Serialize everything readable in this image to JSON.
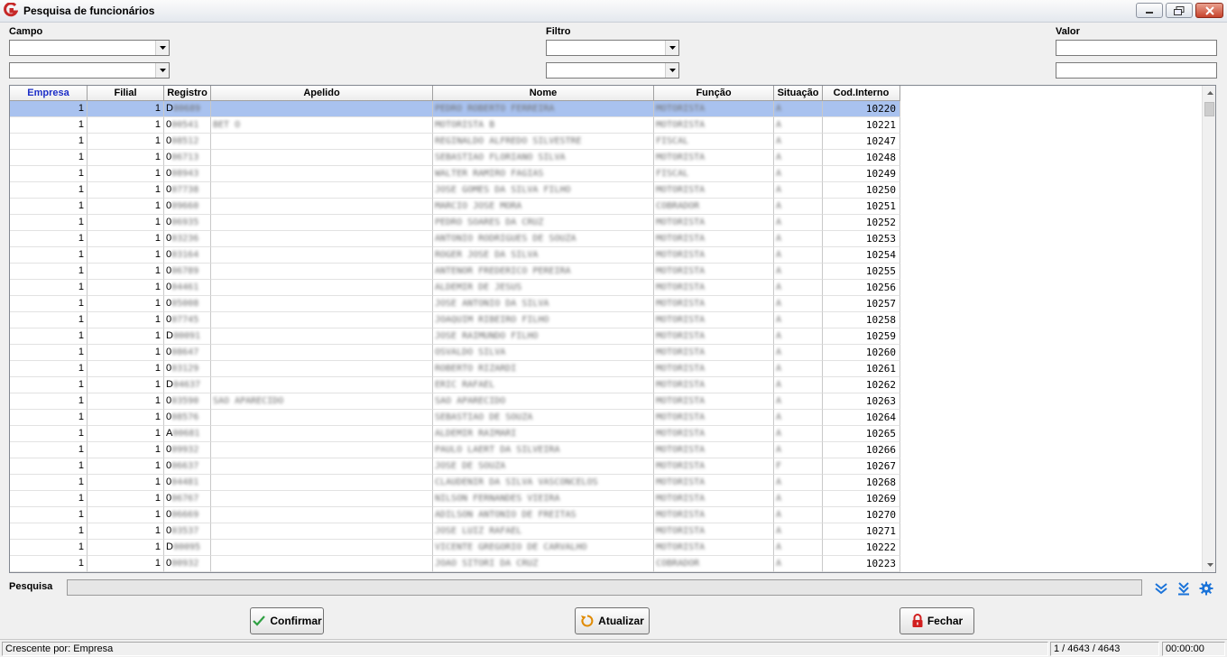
{
  "window": {
    "title": "Pesquisa de funcionários",
    "controls": {
      "minimize": "minimize-icon",
      "restore": "restore-icon",
      "close": "close-icon"
    }
  },
  "filters": {
    "campo_label": "Campo",
    "filtro_label": "Filtro",
    "valor_label": "Valor",
    "campo_values": [
      "",
      ""
    ],
    "filtro_values": [
      "",
      ""
    ],
    "valor_values": [
      "",
      ""
    ]
  },
  "grid": {
    "columns": [
      "Empresa",
      "Filial",
      "Registro",
      "Apelido",
      "Nome",
      "Função",
      "Situação",
      "Cod.Interno"
    ],
    "sorted_column": "Empresa",
    "selected_row": 0,
    "rows": [
      {
        "empresa": "1",
        "filial": "1",
        "registro": "D00689",
        "apelido": "",
        "nome": "PEDRO ROBERTO FERREIRA",
        "funcao": "MOTORISTA",
        "situacao": "A",
        "cod": "10220"
      },
      {
        "empresa": "1",
        "filial": "1",
        "registro": "000541",
        "apelido": "BET O",
        "nome": "MOTORISTA B",
        "funcao": "MOTORISTA",
        "situacao": "A",
        "cod": "10221"
      },
      {
        "empresa": "1",
        "filial": "1",
        "registro": "008512",
        "apelido": "",
        "nome": "REGINALDO ALFREDO SILVESTRE",
        "funcao": "FISCAL",
        "situacao": "A",
        "cod": "10247"
      },
      {
        "empresa": "1",
        "filial": "1",
        "registro": "006713",
        "apelido": "",
        "nome": "SEBASTIAO FLORIANO SILVA",
        "funcao": "MOTORISTA",
        "situacao": "A",
        "cod": "10248"
      },
      {
        "empresa": "1",
        "filial": "1",
        "registro": "008943",
        "apelido": "",
        "nome": "WALTER RAMIRO FAGIAS",
        "funcao": "FISCAL",
        "situacao": "A",
        "cod": "10249"
      },
      {
        "empresa": "1",
        "filial": "1",
        "registro": "007738",
        "apelido": "",
        "nome": "JOSE GOMES DA SILVA FILHO",
        "funcao": "MOTORISTA",
        "situacao": "A",
        "cod": "10250"
      },
      {
        "empresa": "1",
        "filial": "1",
        "registro": "009660",
        "apelido": "",
        "nome": "MARCIO JOSE MORA",
        "funcao": "COBRADOR",
        "situacao": "A",
        "cod": "10251"
      },
      {
        "empresa": "1",
        "filial": "1",
        "registro": "006935",
        "apelido": "",
        "nome": "PEDRO SOARES DA CRUZ",
        "funcao": "MOTORISTA",
        "situacao": "A",
        "cod": "10252"
      },
      {
        "empresa": "1",
        "filial": "1",
        "registro": "003236",
        "apelido": "",
        "nome": "ANTONIO RODRIGUES DE SOUZA",
        "funcao": "MOTORISTA",
        "situacao": "A",
        "cod": "10253"
      },
      {
        "empresa": "1",
        "filial": "1",
        "registro": "003164",
        "apelido": "",
        "nome": "ROGER JOSE DA SILVA",
        "funcao": "MOTORISTA",
        "situacao": "A",
        "cod": "10254"
      },
      {
        "empresa": "1",
        "filial": "1",
        "registro": "006789",
        "apelido": "",
        "nome": "ANTENOR FREDERICO PEREIRA",
        "funcao": "MOTORISTA",
        "situacao": "A",
        "cod": "10255"
      },
      {
        "empresa": "1",
        "filial": "1",
        "registro": "004461",
        "apelido": "",
        "nome": "ALDEMIR DE JESUS",
        "funcao": "MOTORISTA",
        "situacao": "A",
        "cod": "10256"
      },
      {
        "empresa": "1",
        "filial": "1",
        "registro": "005008",
        "apelido": "",
        "nome": "JOSE ANTONIO DA SILVA",
        "funcao": "MOTORISTA",
        "situacao": "A",
        "cod": "10257"
      },
      {
        "empresa": "1",
        "filial": "1",
        "registro": "007745",
        "apelido": "",
        "nome": "JOAQUIM RIBEIRO FILHO",
        "funcao": "MOTORISTA",
        "situacao": "A",
        "cod": "10258"
      },
      {
        "empresa": "1",
        "filial": "1",
        "registro": "D00091",
        "apelido": "",
        "nome": "JOSE RAIMUNDO FILHO",
        "funcao": "MOTORISTA",
        "situacao": "A",
        "cod": "10259"
      },
      {
        "empresa": "1",
        "filial": "1",
        "registro": "008647",
        "apelido": "",
        "nome": "OSVALDO SILVA",
        "funcao": "MOTORISTA",
        "situacao": "A",
        "cod": "10260"
      },
      {
        "empresa": "1",
        "filial": "1",
        "registro": "003129",
        "apelido": "",
        "nome": "ROBERTO RIZARDI",
        "funcao": "MOTORISTA",
        "situacao": "A",
        "cod": "10261"
      },
      {
        "empresa": "1",
        "filial": "1",
        "registro": "D04637",
        "apelido": "",
        "nome": "ERIC RAFAEL",
        "funcao": "MOTORISTA",
        "situacao": "A",
        "cod": "10262"
      },
      {
        "empresa": "1",
        "filial": "1",
        "registro": "003590",
        "apelido": "SAO APARECIDO",
        "nome": "SAO APARECIDO",
        "funcao": "MOTORISTA",
        "situacao": "A",
        "cod": "10263"
      },
      {
        "empresa": "1",
        "filial": "1",
        "registro": "008576",
        "apelido": "",
        "nome": "SEBASTIAO DE SOUZA",
        "funcao": "MOTORISTA",
        "situacao": "A",
        "cod": "10264"
      },
      {
        "empresa": "1",
        "filial": "1",
        "registro": "A00681",
        "apelido": "",
        "nome": "ALDEMIR RAIMARI",
        "funcao": "MOTORISTA",
        "situacao": "A",
        "cod": "10265"
      },
      {
        "empresa": "1",
        "filial": "1",
        "registro": "009932",
        "apelido": "",
        "nome": "PAULO LAERT DA SILVEIRA",
        "funcao": "MOTORISTA",
        "situacao": "A",
        "cod": "10266"
      },
      {
        "empresa": "1",
        "filial": "1",
        "registro": "006637",
        "apelido": "",
        "nome": "JOSE DE SOUZA",
        "funcao": "MOTORISTA",
        "situacao": "F",
        "cod": "10267"
      },
      {
        "empresa": "1",
        "filial": "1",
        "registro": "004481",
        "apelido": "",
        "nome": "CLAUDENIR DA SILVA VASCONCELOS",
        "funcao": "MOTORISTA",
        "situacao": "A",
        "cod": "10268"
      },
      {
        "empresa": "1",
        "filial": "1",
        "registro": "006767",
        "apelido": "",
        "nome": "NILSON FERNANDES VIEIRA",
        "funcao": "MOTORISTA",
        "situacao": "A",
        "cod": "10269"
      },
      {
        "empresa": "1",
        "filial": "1",
        "registro": "006669",
        "apelido": "",
        "nome": "ADILSON ANTONIO DE FREITAS",
        "funcao": "MOTORISTA",
        "situacao": "A",
        "cod": "10270"
      },
      {
        "empresa": "1",
        "filial": "1",
        "registro": "003537",
        "apelido": "",
        "nome": "JOSE LUIZ RAFAEL",
        "funcao": "MOTORISTA",
        "situacao": "A",
        "cod": "10271"
      },
      {
        "empresa": "1",
        "filial": "1",
        "registro": "D00095",
        "apelido": "",
        "nome": "VICENTE GREGORIO DE CARVALHO",
        "funcao": "MOTORISTA",
        "situacao": "A",
        "cod": "10222"
      },
      {
        "empresa": "1",
        "filial": "1",
        "registro": "000932",
        "apelido": "",
        "nome": "JOAO SITORI DA CRUZ",
        "funcao": "COBRADOR",
        "situacao": "A",
        "cod": "10223"
      }
    ]
  },
  "search": {
    "label": "Pesquisa",
    "value": ""
  },
  "tools": [
    "double-chevron-down-icon",
    "chevron-down-to-line-icon",
    "gear-icon"
  ],
  "buttons": {
    "confirm": "Confirmar",
    "refresh": "Atualizar",
    "close": "Fechar"
  },
  "colors": {
    "selected_row": "#a9c2ef",
    "sorted_header": "#1c2ec7",
    "confirm_icon": "#2fa043",
    "refresh_icon": "#e08a00",
    "close_icon": "#d11e1e",
    "tool_icon": "#1a73d9"
  },
  "status": {
    "sort": "Crescente por: Empresa",
    "count": "1 / 4643 / 4643",
    "time": "00:00:00"
  }
}
